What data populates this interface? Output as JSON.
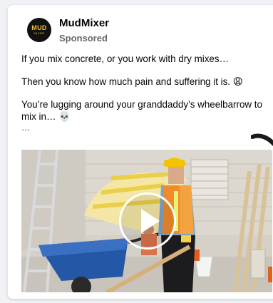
{
  "post": {
    "page_name": "MudMixer",
    "sponsored_label": "Sponsored",
    "logo": {
      "line1": "MUD",
      "line2": "MIXER"
    },
    "text": {
      "line1": "If you mix concrete, or you work with dry mixes…",
      "line2": "Then you know how much pain and suffering it is. 😩",
      "line3": "You’re lugging around your granddaddy’s wheelbarrow to mix in… 💀",
      "ellipsis": "…"
    },
    "video": {
      "play_icon": "play-icon"
    }
  },
  "colors": {
    "page_bg": "#f0f2f5",
    "card_bg": "#ffffff",
    "name_text": "#050505",
    "meta_text": "#65676b",
    "logo_bg": "#111111",
    "logo_accent": "#f2c233"
  }
}
